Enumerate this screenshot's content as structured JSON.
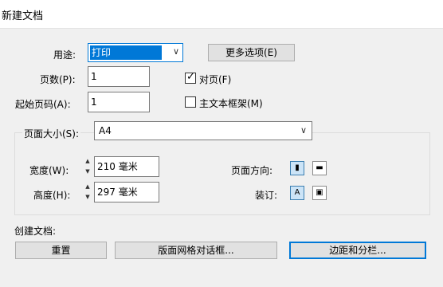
{
  "window": {
    "title": "新建文档"
  },
  "purpose": {
    "label": "用途:",
    "value": "打印"
  },
  "more_options_button": "更多选项(E)",
  "pages": {
    "label": "页数(P):",
    "value": "1"
  },
  "start_page": {
    "label": "起始页码(A):",
    "value": "1"
  },
  "facing_pages": {
    "label": "对页(F)",
    "checked": true
  },
  "master_text_frame": {
    "label": "主文本框架(M)",
    "checked": false
  },
  "page_size": {
    "label": "页面大小(S):",
    "value": "A4"
  },
  "width": {
    "label": "宽度(W):",
    "value": "210 毫米"
  },
  "height": {
    "label": "高度(H):",
    "value": "297 毫米"
  },
  "orientation": {
    "label": "页面方向:",
    "options": [
      "portrait-icon",
      "landscape-icon"
    ],
    "selected": "portrait-icon"
  },
  "binding": {
    "label": "装订:",
    "options": [
      "left-to-right-icon",
      "right-to-left-icon"
    ],
    "selected": "left-to-right-icon"
  },
  "create_document": {
    "label": "创建文档:"
  },
  "buttons": {
    "reset": "重置",
    "layout_grid": "版面网格对话框...",
    "margins_columns": "边距和分栏..."
  }
}
